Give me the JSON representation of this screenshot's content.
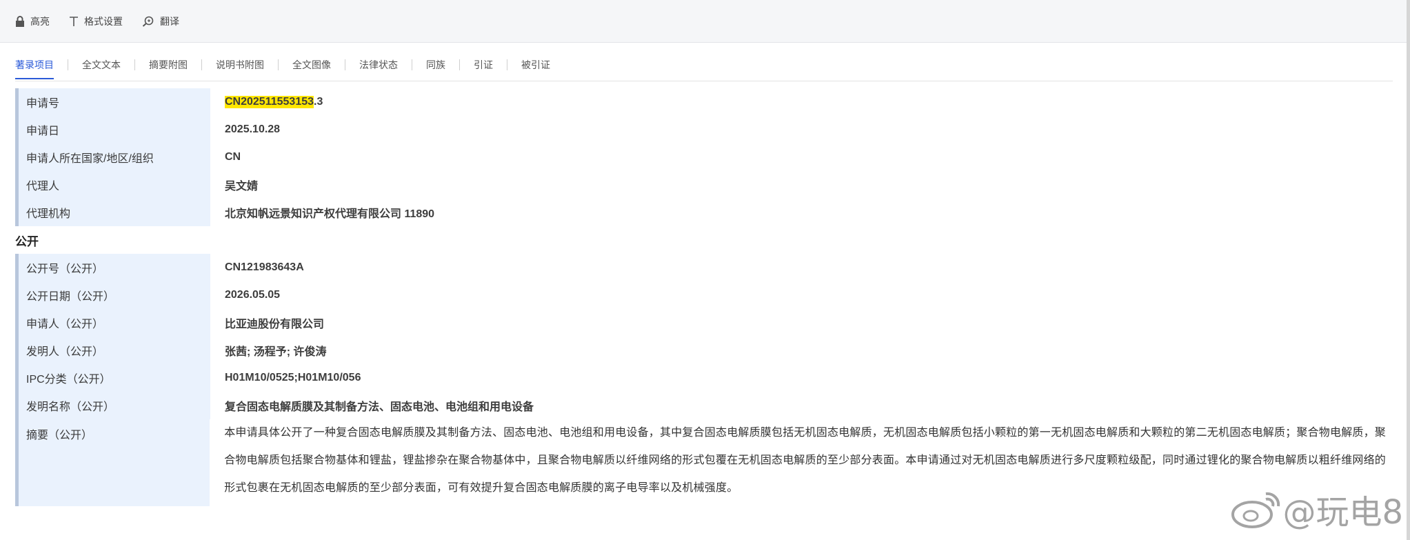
{
  "toolbar": {
    "highlight_label": "高亮",
    "format_label": "格式设置",
    "translate_label": "翻译"
  },
  "tabs": [
    {
      "label": "著录项目",
      "active": true
    },
    {
      "label": "全文文本"
    },
    {
      "label": "摘要附图"
    },
    {
      "label": "说明书附图"
    },
    {
      "label": "全文图像"
    },
    {
      "label": "法律状态"
    },
    {
      "label": "同族"
    },
    {
      "label": "引证"
    },
    {
      "label": "被引证"
    }
  ],
  "application": {
    "app_no_label": "申请号",
    "app_no_highlight": "CN202511553153",
    "app_no_suffix": ".3",
    "app_date_label": "申请日",
    "app_date": "2025.10.28",
    "country_label": "申请人所在国家/地区/组织",
    "country": "CN",
    "agent_label": "代理人",
    "agent": "吴文婧",
    "agency_label": "代理机构",
    "agency": "北京知帆远景知识产权代理有限公司 11890"
  },
  "publication": {
    "section_title": "公开",
    "pub_no_label": "公开号（公开）",
    "pub_no": "CN121983643A",
    "pub_date_label": "公开日期（公开）",
    "pub_date": "2026.05.05",
    "applicant_label": "申请人（公开）",
    "applicant": "比亚迪股份有限公司",
    "inventor_label": "发明人（公开）",
    "inventor": "张茜; 汤程予; 许俊涛",
    "ipc_label": "IPC分类（公开）",
    "ipc": "H01M10/0525;H01M10/056",
    "title_label": "发明名称（公开）",
    "title": "复合固态电解质膜及其制备方法、固态电池、电池组和用电设备",
    "abstract_label": "摘要（公开）",
    "abstract": "本申请具体公开了一种复合固态电解质膜及其制备方法、固态电池、电池组和用电设备，其中复合固态电解质膜包括无机固态电解质，无机固态电解质包括小颗粒的第一无机固态电解质和大颗粒的第二无机固态电解质；聚合物电解质，聚合物电解质包括聚合物基体和锂盐，锂盐掺杂在聚合物基体中，且聚合物电解质以纤维网络的形式包覆在无机固态电解质的至少部分表面。本申请通过对无机固态电解质进行多尺度颗粒级配，同时通过锂化的聚合物电解质以粗纤维网络的形式包裹在无机固态电解质的至少部分表面，可有效提升复合固态电解质膜的离子电导率以及机械强度。"
  },
  "watermark": {
    "text": "@玩电8"
  },
  "colors": {
    "accent": "#2a5ad8",
    "highlight": "#ffe600",
    "label_bg": "#eaf2fd"
  }
}
